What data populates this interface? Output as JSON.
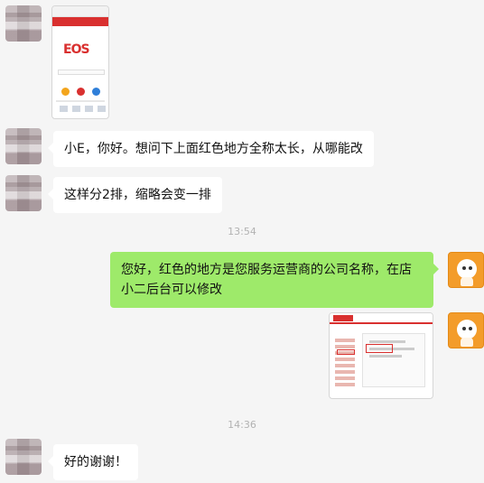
{
  "messages": [
    {
      "id": "m1",
      "side": "left",
      "type": "image",
      "desc": "phone-screenshot"
    },
    {
      "id": "m2",
      "side": "left",
      "type": "text",
      "text": "小E，你好。想问下上面红色地方全称太长，从哪能改"
    },
    {
      "id": "m3",
      "side": "left",
      "type": "text",
      "text": "这样分2排，缩略会变一排"
    },
    {
      "id": "t1",
      "type": "time",
      "text": "13:54"
    },
    {
      "id": "m4",
      "side": "right",
      "type": "text",
      "text": "您好，红色的地方是您服务运营商的公司名称，在店小二后台可以修改"
    },
    {
      "id": "m5",
      "side": "right",
      "type": "image",
      "desc": "admin-screenshot"
    },
    {
      "id": "t2",
      "type": "time",
      "text": "14:36"
    },
    {
      "id": "m6",
      "side": "left",
      "type": "text",
      "text": "好的谢谢！"
    }
  ],
  "phone_screenshot": {
    "logo_text": "EOS"
  },
  "colors": {
    "background": "#f5f5f5",
    "left_bubble": "#ffffff",
    "right_bubble": "#9eea6a",
    "brand_red": "#d9302f",
    "mascot_orange": "#f39c2a"
  }
}
